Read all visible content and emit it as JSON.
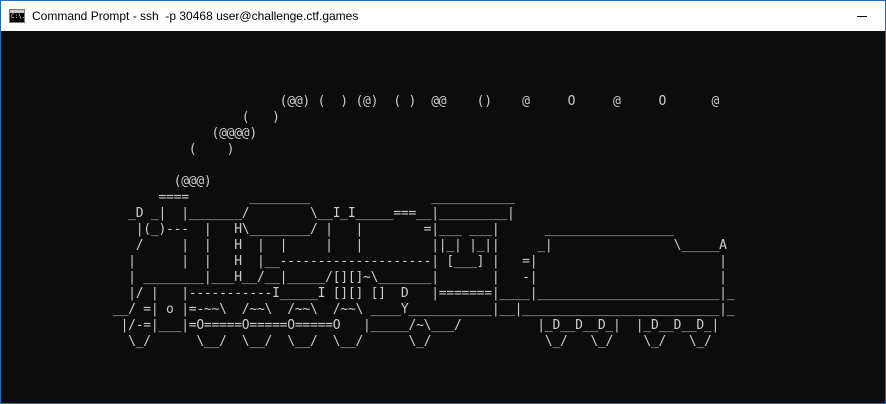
{
  "window": {
    "title": "Command Prompt - ssh  -p 30468 user@challenge.ctf.games",
    "icon": "cmd-icon",
    "icon_text": "C:\\.",
    "controls": [
      "minimize"
    ]
  },
  "console": {
    "text_color": "#cccccc",
    "background": "#0c0c0c",
    "lines": [
      "                      (@@) (  ) (@)  ( )  @@    ()    @     O     @     O      @",
      "                 (   )",
      "             (@@@@)",
      "          (    )",
      "",
      "        (@@@)",
      "      ====        ________                ___________",
      "  _D _|  |_______/        \\__I_I_____===__|_________|",
      "   |(_)---  |   H\\________/ |   |        =|___ ___|      _________________",
      "   /     |  |   H  |  |     |   |         ||_| |_||     _|                \\_____A",
      "  |      |  |   H  |__--------------------| [___] |   =|                        |",
      "  | ________|___H__/__|_____/[][]~\\_______|       |   -|                        |",
      "  |/ |   |-----------I_____I [][] []  D   |=======|____|________________________|_",
      "__/ =| o |=-~~\\  /~~\\  /~~\\  /~~\\ ____Y___________|__|__________________________|_",
      " |/-=|___|=O=====O=====O=====O   |_____/~\\___/          |_D__D__D_|  |_D__D__D_|",
      "  \\_/      \\__/  \\__/  \\__/  \\__/      \\_/               \\_/   \\_/    \\_/   \\_/"
    ]
  }
}
